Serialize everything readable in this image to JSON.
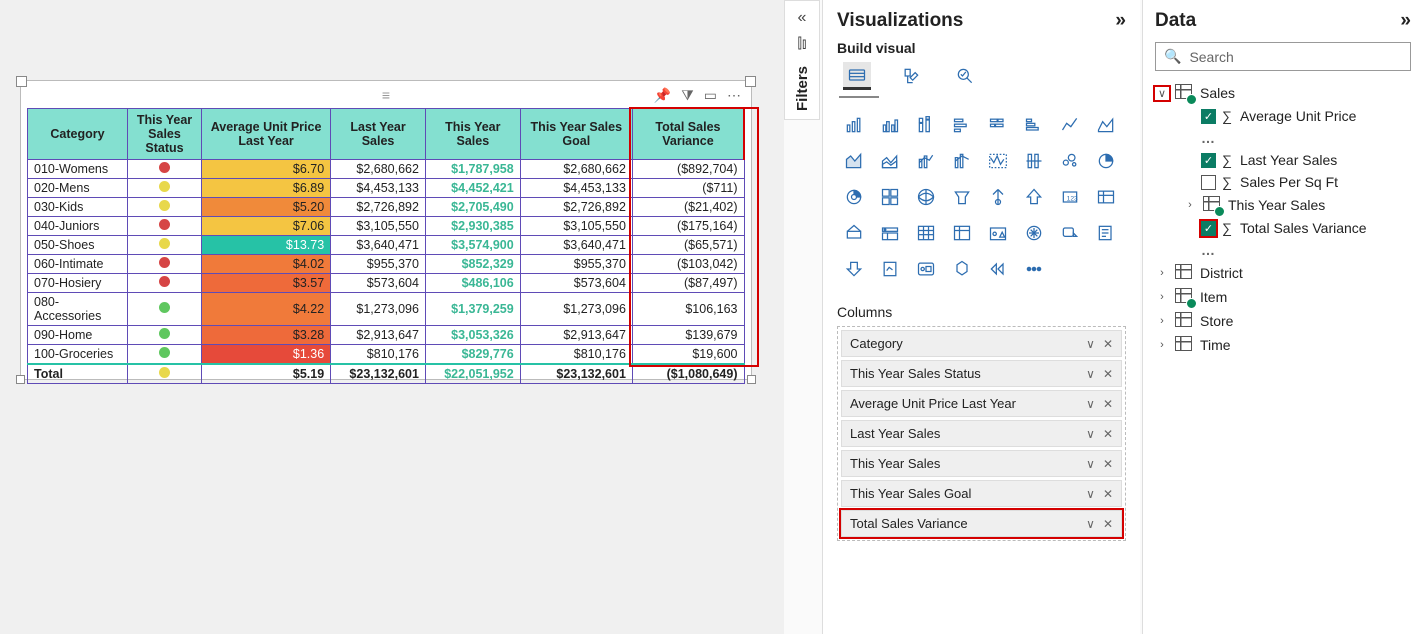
{
  "table": {
    "headers": [
      "Category",
      "This Year Sales Status",
      "Average Unit Price Last Year",
      "Last Year Sales",
      "This Year Sales",
      "This Year Sales Goal",
      "Total Sales Variance"
    ],
    "rows": [
      {
        "cat": "010-Womens",
        "status": "red",
        "aup": "$6.70",
        "aup_cls": "cell-yl",
        "ly": "$2,680,662",
        "ty": "$1,787,958",
        "goal": "$2,680,662",
        "var": "($892,704)"
      },
      {
        "cat": "020-Mens",
        "status": "yellow",
        "aup": "$6.89",
        "aup_cls": "cell-yl",
        "ly": "$4,453,133",
        "ty": "$4,452,421",
        "goal": "$4,453,133",
        "var": "($711)"
      },
      {
        "cat": "030-Kids",
        "status": "yellow",
        "aup": "$5.20",
        "aup_cls": "cell-or1",
        "ly": "$2,726,892",
        "ty": "$2,705,490",
        "goal": "$2,726,892",
        "var": "($21,402)"
      },
      {
        "cat": "040-Juniors",
        "status": "red",
        "aup": "$7.06",
        "aup_cls": "cell-yl",
        "ly": "$3,105,550",
        "ty": "$2,930,385",
        "goal": "$3,105,550",
        "var": "($175,164)"
      },
      {
        "cat": "050-Shoes",
        "status": "yellow",
        "aup": "$13.73",
        "aup_cls": "cell-teal",
        "ly": "$3,640,471",
        "ty": "$3,574,900",
        "goal": "$3,640,471",
        "var": "($65,571)"
      },
      {
        "cat": "060-Intimate",
        "status": "red",
        "aup": "$4.02",
        "aup_cls": "cell-or2",
        "ly": "$955,370",
        "ty": "$852,329",
        "goal": "$955,370",
        "var": "($103,042)"
      },
      {
        "cat": "070-Hosiery",
        "status": "red",
        "aup": "$3.57",
        "aup_cls": "cell-or3",
        "ly": "$573,604",
        "ty": "$486,106",
        "goal": "$573,604",
        "var": "($87,497)"
      },
      {
        "cat": "080-Accessories",
        "status": "green",
        "aup": "$4.22",
        "aup_cls": "cell-or2",
        "ly": "$1,273,096",
        "ty": "$1,379,259",
        "goal": "$1,273,096",
        "var": "$106,163"
      },
      {
        "cat": "090-Home",
        "status": "green",
        "aup": "$3.28",
        "aup_cls": "cell-or3",
        "ly": "$2,913,647",
        "ty": "$3,053,326",
        "goal": "$2,913,647",
        "var": "$139,679"
      },
      {
        "cat": "100-Groceries",
        "status": "green",
        "aup": "$1.36",
        "aup_cls": "cell-rd",
        "ly": "$810,176",
        "ty": "$829,776",
        "goal": "$810,176",
        "var": "$19,600"
      }
    ],
    "total": {
      "cat": "Total",
      "status": "yellow",
      "aup": "$5.19",
      "ly": "$23,132,601",
      "ty": "$22,051,952",
      "goal": "$23,132,601",
      "var": "($1,080,649)"
    }
  },
  "filters_label": "Filters",
  "viz": {
    "title": "Visualizations",
    "build": "Build visual",
    "columns_label": "Columns",
    "columns": [
      "Category",
      "This Year Sales Status",
      "Average Unit Price Last Year",
      "Last Year Sales",
      "This Year Sales",
      "This Year Sales Goal",
      "Total Sales Variance"
    ]
  },
  "data": {
    "title": "Data",
    "search_placeholder": "Search",
    "tables": {
      "sales": "Sales",
      "fields": {
        "aup": "Average Unit Price",
        "lys": "Last Year Sales",
        "spsf": "Sales Per Sq Ft",
        "tys": "This Year Sales",
        "tsv": "Total Sales Variance"
      },
      "district": "District",
      "item": "Item",
      "store": "Store",
      "time": "Time"
    }
  }
}
